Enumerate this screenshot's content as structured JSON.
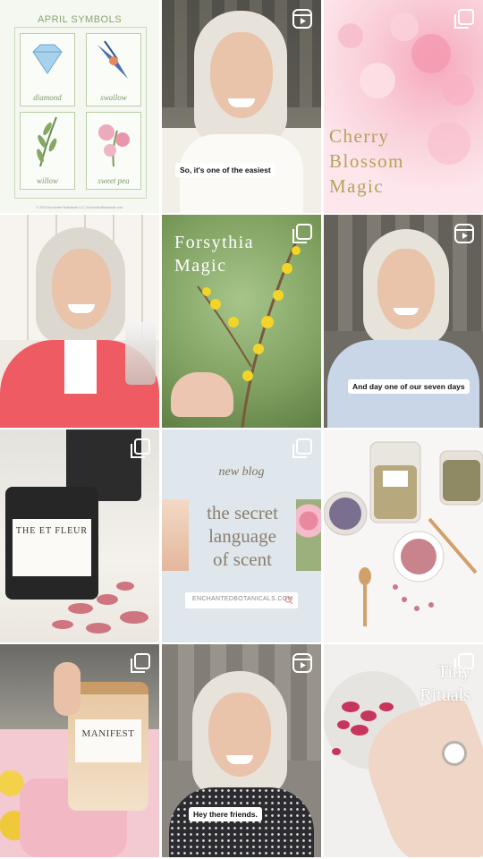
{
  "tiles": [
    {
      "kind": "symbols",
      "title": "APRIL SYMBOLS",
      "labels": [
        "diamond",
        "swallow",
        "willow",
        "sweet pea"
      ],
      "footer": "© 2025 Enchanted Botanicals LLC  |  EnchantedBotanicals.com"
    },
    {
      "kind": "video",
      "badge": "reel-icon",
      "caption": "So, it's one of the easiest"
    },
    {
      "kind": "photo",
      "badge": "carousel-icon",
      "title_lines": [
        "Cherry",
        "Blossom",
        "Magic"
      ]
    },
    {
      "kind": "photo",
      "badge": "none"
    },
    {
      "kind": "photo",
      "badge": "carousel-icon",
      "title_lines": [
        "Forsythia",
        "Magic"
      ]
    },
    {
      "kind": "video",
      "badge": "reel-icon",
      "caption": "And day one of our seven days"
    },
    {
      "kind": "photo",
      "badge": "carousel-icon",
      "product": "THE ET FLEUR"
    },
    {
      "kind": "blog",
      "badge": "carousel-icon",
      "kicker": "new blog",
      "title_lines": [
        "the secret",
        "language",
        "of scent"
      ],
      "url": "ENCHANTEDBOTANICALS.COM"
    },
    {
      "kind": "photo",
      "badge": "none"
    },
    {
      "kind": "photo",
      "badge": "carousel-icon",
      "product": "MANIFEST"
    },
    {
      "kind": "video",
      "badge": "reel-icon",
      "caption": "Hey there friends."
    },
    {
      "kind": "photo",
      "badge": "carousel-icon",
      "title_lines": [
        "Tiny",
        "Rituals"
      ]
    }
  ],
  "colors": {
    "sage": "#8ea37a",
    "gold": "#b8a05c",
    "blush": "#f3c9d2",
    "coral": "#ef5b62",
    "slate": "#dfe6ec"
  }
}
